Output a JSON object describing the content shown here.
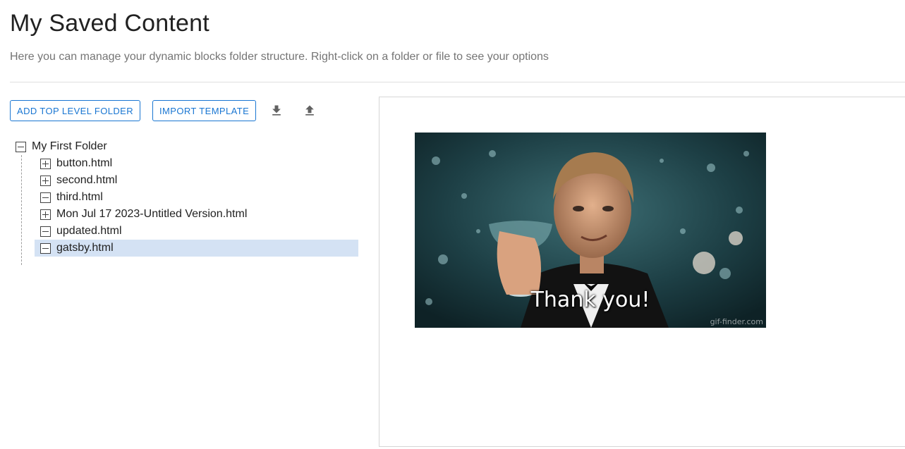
{
  "header": {
    "title": "My Saved Content",
    "subtitle": "Here you can manage your dynamic blocks folder structure. Right-click on a folder or file to see your options"
  },
  "toolbar": {
    "add_folder_label": "ADD TOP LEVEL FOLDER",
    "import_label": "IMPORT TEMPLATE",
    "download_icon": "download-icon",
    "upload_icon": "upload-icon"
  },
  "tree": {
    "root": {
      "label": "My First Folder",
      "expanded": true
    },
    "items": [
      {
        "label": "button.html",
        "expanded": false,
        "selected": false
      },
      {
        "label": "second.html",
        "expanded": false,
        "selected": false
      },
      {
        "label": "third.html",
        "expanded": true,
        "selected": false
      },
      {
        "label": "Mon Jul 17 2023-Untitled Version.html",
        "expanded": false,
        "selected": false
      },
      {
        "label": "updated.html",
        "expanded": true,
        "selected": false
      },
      {
        "label": "gatsby.html",
        "expanded": true,
        "selected": true
      }
    ]
  },
  "preview": {
    "caption": "Thank you!",
    "watermark": "gif-finder.com"
  },
  "colors": {
    "accent": "#1976d2",
    "selected_row": "#d4e2f4"
  }
}
